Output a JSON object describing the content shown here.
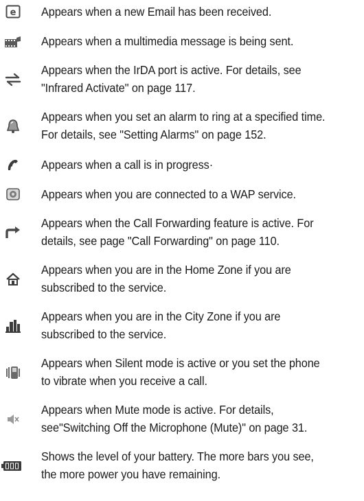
{
  "entries": [
    {
      "icon": "email-icon",
      "lines": [
        "Appears when a new Email has been received."
      ]
    },
    {
      "icon": "multimedia-message-sending-icon",
      "lines": [
        "Appears when a multimedia message is being sent."
      ]
    },
    {
      "icon": "irda-port-icon",
      "lines": [
        "Appears when the IrDA port is active. For details, see",
        "\"Infrared Activate\" on page 117."
      ]
    },
    {
      "icon": "alarm-bell-icon",
      "lines": [
        "Appears when you set an alarm to ring at a specified time.",
        "For details, see \"Setting Alarms\" on page 152."
      ]
    },
    {
      "icon": "call-in-progress-icon",
      "lines": [
        "Appears when a call is in progress·"
      ]
    },
    {
      "icon": "wap-service-icon",
      "lines": [
        "Appears when you are connected to a WAP service."
      ]
    },
    {
      "icon": "call-forwarding-icon",
      "lines": [
        "Appears when the Call Forwarding feature is active. For",
        "details, see page \"Call Forwarding\" on page 110."
      ]
    },
    {
      "icon": "home-zone-icon",
      "lines": [
        "Appears when you are in the Home Zone if you are",
        "subscribed to the service."
      ]
    },
    {
      "icon": "city-zone-icon",
      "lines": [
        "Appears when you are in the City Zone if you are",
        "subscribed to the service."
      ]
    },
    {
      "icon": "silent-mode-vibrate-icon",
      "lines": [
        "Appears when Silent mode is active or you set the phone",
        "to vibrate when you receive a call."
      ]
    },
    {
      "icon": "mute-icon",
      "lines": [
        "Appears when Mute mode is active. For details,",
        "see\"Switching Off the Microphone (Mute)\" on page 31."
      ]
    },
    {
      "icon": "battery-level-icon",
      "lines": [
        "Shows the level of your battery. The more bars you see,",
        "the more power you have remaining."
      ]
    }
  ]
}
